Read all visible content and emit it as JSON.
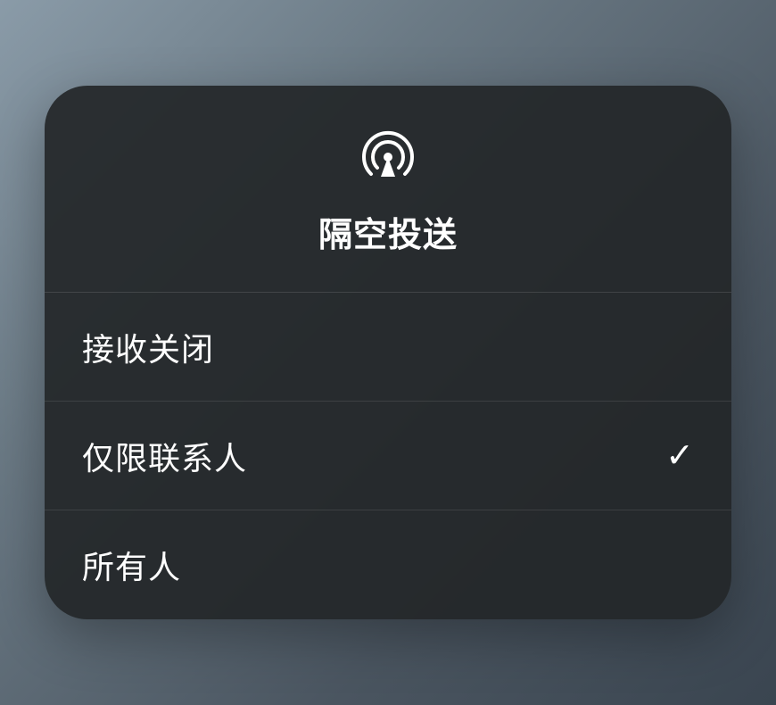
{
  "panel": {
    "title": "隔空投送",
    "icon_name": "airdrop-icon"
  },
  "options": [
    {
      "label": "接收关闭",
      "selected": false
    },
    {
      "label": "仅限联系人",
      "selected": true
    },
    {
      "label": "所有人",
      "selected": false
    }
  ]
}
